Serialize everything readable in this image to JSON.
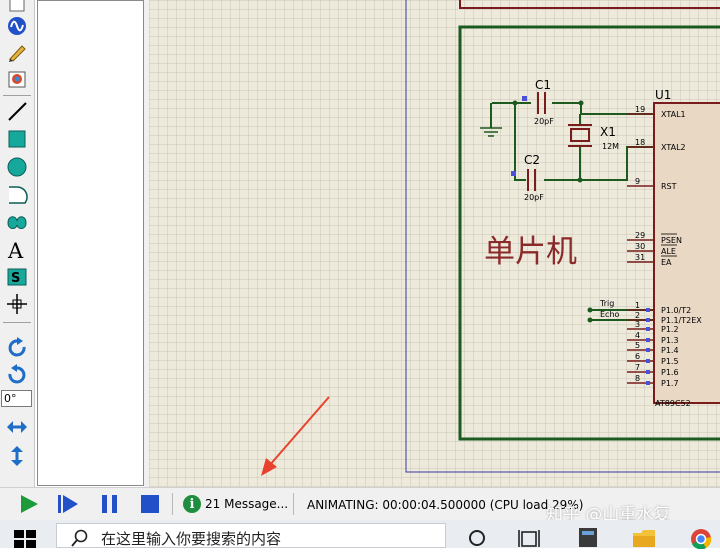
{
  "toolbar": {
    "angle_value": "0°",
    "tools": [
      "select-icon",
      "wire-icon",
      "pencil-icon",
      "palette-icon",
      "line-icon",
      "box-icon",
      "circle-icon",
      "arc-icon",
      "path-icon",
      "text-icon",
      "symbol-icon",
      "marker-icon",
      "rotate-cw-icon",
      "rotate-ccw-icon",
      "mirror-h-icon",
      "mirror-v-icon"
    ]
  },
  "schematic": {
    "c1": {
      "ref": "C1",
      "value": "20pF"
    },
    "c2": {
      "ref": "C2",
      "value": "20pF"
    },
    "x1": {
      "ref": "X1",
      "value": "12M"
    },
    "u1": {
      "ref": "U1",
      "part": "AT89C52"
    },
    "pins": [
      {
        "num": "19",
        "name": "XTAL1"
      },
      {
        "num": "18",
        "name": "XTAL2"
      },
      {
        "num": "9",
        "name": "RST"
      },
      {
        "num": "29",
        "name": "PSEN"
      },
      {
        "num": "30",
        "name": "ALE"
      },
      {
        "num": "31",
        "name": "EA"
      },
      {
        "num": "1",
        "name": "P1.0/T2"
      },
      {
        "num": "2",
        "name": "P1.1/T2EX"
      },
      {
        "num": "3",
        "name": "P1.2"
      },
      {
        "num": "4",
        "name": "P1.3"
      },
      {
        "num": "5",
        "name": "P1.4"
      },
      {
        "num": "6",
        "name": "P1.5"
      },
      {
        "num": "7",
        "name": "P1.6"
      },
      {
        "num": "8",
        "name": "P1.7"
      }
    ],
    "net_trig": "Trig",
    "net_echo": "Echo",
    "block_label": "单片机"
  },
  "statusbar": {
    "messages": "21 Message...",
    "status": "ANIMATING: 00:00:04.500000 (CPU load 29%)"
  },
  "watermark": "知乎 @山重水复",
  "taskbar": {
    "search_placeholder": "在这里输入你要搜索的内容"
  },
  "colors": {
    "grid_bg": "#edeadc",
    "sheet_border": "#3b3b9c",
    "block_border": "#1c5a20",
    "component": "#7a1c1c",
    "pin_marker": "#4b50d8",
    "arrow": "#e8412d"
  }
}
